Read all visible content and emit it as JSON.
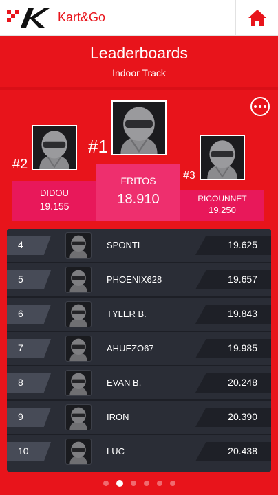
{
  "app": {
    "name": "Kart&Go"
  },
  "header": {
    "title": "Leaderboards",
    "subtitle": "Indoor Track"
  },
  "icons": {
    "logo": "kart-and-go-logo",
    "home": "home-icon",
    "more": "more-options-icon",
    "avatar": "helmet-avatar-icon"
  },
  "colors": {
    "brand_red": "#e8141b",
    "podium_pink": "#e8185a",
    "list_bg": "#2a2d36"
  },
  "podium": {
    "first": {
      "rank": "#1",
      "name": "FRITOS",
      "time": "18.910"
    },
    "second": {
      "rank": "#2",
      "name": "DIDOU",
      "time": "19.155"
    },
    "third": {
      "rank": "#3",
      "name": "RICOUNNET",
      "time": "19.250"
    }
  },
  "rows": [
    {
      "rank": "4",
      "name": "SPONTI",
      "time": "19.625"
    },
    {
      "rank": "5",
      "name": "PHOENIX628",
      "time": "19.657"
    },
    {
      "rank": "6",
      "name": "TYLER B.",
      "time": "19.843"
    },
    {
      "rank": "7",
      "name": "AHUEZO67",
      "time": "19.985"
    },
    {
      "rank": "8",
      "name": "EVAN B.",
      "time": "20.248"
    },
    {
      "rank": "9",
      "name": "IRON",
      "time": "20.390"
    },
    {
      "rank": "10",
      "name": "LUC",
      "time": "20.438"
    }
  ],
  "pager": {
    "total": 6,
    "active": 2
  }
}
